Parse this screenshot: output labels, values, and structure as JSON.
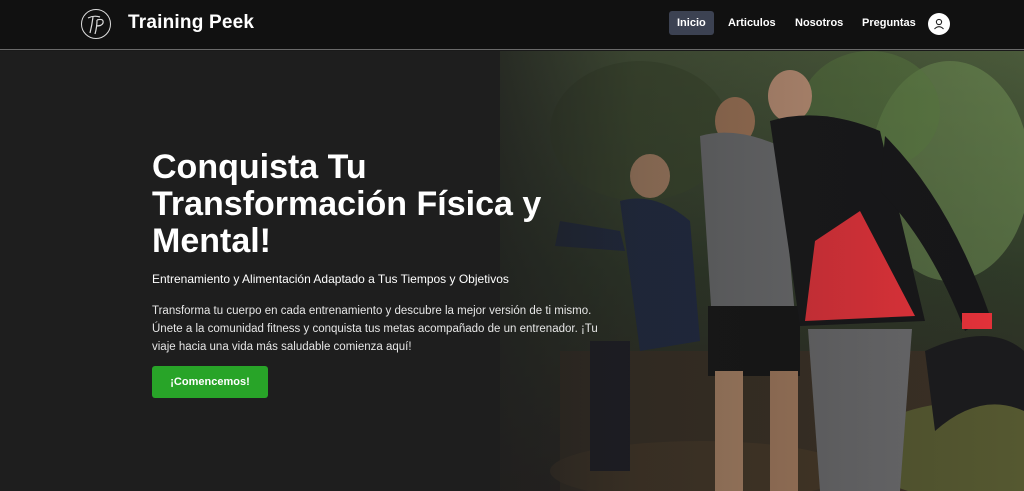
{
  "brand": {
    "name": "Training Peek",
    "logo_icon": "tp-monogram-logo"
  },
  "nav": {
    "items": [
      {
        "label": "Inicio",
        "active": true
      },
      {
        "label": "Articulos",
        "active": false
      },
      {
        "label": "Nosotros",
        "active": false
      },
      {
        "label": "Preguntas",
        "active": false
      }
    ],
    "user_icon": "user-icon"
  },
  "hero": {
    "title": "Conquista Tu Transformación Física y Mental!",
    "subtitle": "Entrenamiento y Alimentación Adaptado a Tus Tiempos y Objetivos",
    "body": "Transforma tu cuerpo en cada entrenamiento y descubre la mejor versión de ti mismo. Únete a la comunidad fitness y conquista tus metas acompañado de un entrenador. ¡Tu viaje hacia una vida más saludable comienza aquí!",
    "cta_label": "¡Comencemos!"
  },
  "colors": {
    "navbar_bg": "#111111",
    "active_nav_bg": "#3c4252",
    "cta_bg": "#28a428",
    "accent_red": "#e8323a"
  }
}
